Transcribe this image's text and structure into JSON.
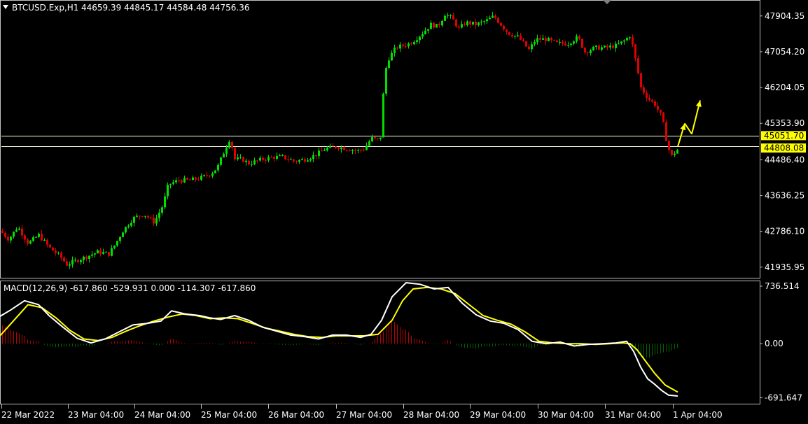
{
  "colors": {
    "background": "#000000",
    "border": "#c0c0c0",
    "text": "#ffffff",
    "bull": "#00e000",
    "bear": "#e00000",
    "level_line": "#ffffe0",
    "price_tag_bg": "#ffff00",
    "price_tag_text": "#000000",
    "arrow": "#ffff00",
    "macd_line": "#ffffff",
    "signal_line": "#ffff00",
    "hist_pos": "#c00000",
    "hist_neg": "#006400"
  },
  "price_panel": {
    "header": {
      "symbol": "BTCUSD.Exp,H1",
      "ohlc": "44659.39 44845.17 44584.48 44756.36",
      "dropdown_icon": "triangle-down-icon"
    }
  },
  "macd_panel": {
    "header": "MACD(12,26,9) -617.860 -529.931 0.000 -114.307 -617.860"
  },
  "chart_data": [
    {
      "type": "candlestick",
      "title": "BTCUSD.Exp,H1",
      "x_ticks": [
        "22 Mar 2022",
        "23 Mar 04:00",
        "24 Mar 04:00",
        "25 Mar 04:00",
        "26 Mar 04:00",
        "27 Mar 04:00",
        "28 Mar 04:00",
        "29 Mar 04:00",
        "30 Mar 04:00",
        "31 Mar 04:00",
        "1 Apr 04:00"
      ],
      "y_ticks": [
        "47904.35",
        "47054.20",
        "46204.05",
        "45353.90",
        "44486.40",
        "43636.25",
        "42786.10",
        "41935.95"
      ],
      "ylim": [
        41700,
        48250
      ],
      "price_levels": [
        45051.7,
        44808.08
      ],
      "price_level_labels": [
        "45051.70",
        "44808.08"
      ],
      "close_path": [
        [
          0,
          42800
        ],
        [
          12,
          42600
        ],
        [
          25,
          42900
        ],
        [
          40,
          42500
        ],
        [
          55,
          42700
        ],
        [
          70,
          42400
        ],
        [
          85,
          42200
        ],
        [
          95,
          42000
        ],
        [
          110,
          42100
        ],
        [
          125,
          42200
        ],
        [
          140,
          42300
        ],
        [
          155,
          42250
        ],
        [
          165,
          42500
        ],
        [
          175,
          42800
        ],
        [
          190,
          43100
        ],
        [
          205,
          43200
        ],
        [
          220,
          43000
        ],
        [
          232,
          43400
        ],
        [
          240,
          43900
        ],
        [
          255,
          44000
        ],
        [
          270,
          44000
        ],
        [
          285,
          44050
        ],
        [
          300,
          44150
        ],
        [
          310,
          44300
        ],
        [
          320,
          44700
        ],
        [
          328,
          45000
        ],
        [
          335,
          44500
        ],
        [
          345,
          44500
        ],
        [
          355,
          44400
        ],
        [
          365,
          44450
        ],
        [
          375,
          44500
        ],
        [
          390,
          44550
        ],
        [
          405,
          44550
        ],
        [
          420,
          44450
        ],
        [
          435,
          44500
        ],
        [
          450,
          44600
        ],
        [
          465,
          44750
        ],
        [
          480,
          44800
        ],
        [
          495,
          44750
        ],
        [
          510,
          44700
        ],
        [
          520,
          44750
        ],
        [
          530,
          45000
        ],
        [
          540,
          44950
        ],
        [
          545,
          45100
        ],
        [
          548,
          46500
        ],
        [
          555,
          46900
        ],
        [
          565,
          47150
        ],
        [
          575,
          47200
        ],
        [
          585,
          47250
        ],
        [
          600,
          47450
        ],
        [
          615,
          47700
        ],
        [
          625,
          47650
        ],
        [
          635,
          47950
        ],
        [
          645,
          47850
        ],
        [
          655,
          47600
        ],
        [
          665,
          47750
        ],
        [
          680,
          47700
        ],
        [
          695,
          47800
        ],
        [
          705,
          47900
        ],
        [
          715,
          47700
        ],
        [
          725,
          47500
        ],
        [
          740,
          47400
        ],
        [
          755,
          47100
        ],
        [
          765,
          47350
        ],
        [
          780,
          47350
        ],
        [
          795,
          47250
        ],
        [
          810,
          47250
        ],
        [
          825,
          47400
        ],
        [
          835,
          47050
        ],
        [
          850,
          47150
        ],
        [
          865,
          47150
        ],
        [
          880,
          47200
        ],
        [
          890,
          47300
        ],
        [
          900,
          47450
        ],
        [
          908,
          46800
        ],
        [
          915,
          46200
        ],
        [
          925,
          45950
        ],
        [
          935,
          45800
        ],
        [
          945,
          45500
        ],
        [
          952,
          44900
        ],
        [
          958,
          44550
        ],
        [
          965,
          44700
        ],
        [
          970,
          44750
        ]
      ],
      "annotations": [
        {
          "type": "arrow",
          "points": [
            [
              968,
              44800
            ],
            [
              978,
              45350
            ]
          ]
        },
        {
          "type": "arrow",
          "points": [
            [
              988,
              45100
            ],
            [
              1000,
              45900
            ]
          ]
        }
      ]
    },
    {
      "type": "line",
      "title": "MACD(12,26,9)",
      "y_ticks": [
        "736.514",
        "0.00",
        "-691.647"
      ],
      "ylim": [
        -760,
        790
      ],
      "series": [
        {
          "name": "MACD",
          "points": [
            [
              0,
              350
            ],
            [
              15,
              430
            ],
            [
              35,
              550
            ],
            [
              55,
              500
            ],
            [
              70,
              360
            ],
            [
              90,
              210
            ],
            [
              110,
              70
            ],
            [
              130,
              10
            ],
            [
              150,
              60
            ],
            [
              170,
              150
            ],
            [
              190,
              240
            ],
            [
              210,
              260
            ],
            [
              230,
              290
            ],
            [
              245,
              420
            ],
            [
              265,
              380
            ],
            [
              285,
              360
            ],
            [
              300,
              330
            ],
            [
              315,
              310
            ],
            [
              335,
              360
            ],
            [
              355,
              300
            ],
            [
              375,
              210
            ],
            [
              395,
              160
            ],
            [
              415,
              110
            ],
            [
              435,
              90
            ],
            [
              455,
              60
            ],
            [
              475,
              110
            ],
            [
              495,
              110
            ],
            [
              515,
              80
            ],
            [
              530,
              120
            ],
            [
              545,
              300
            ],
            [
              560,
              600
            ],
            [
              580,
              780
            ],
            [
              600,
              760
            ],
            [
              620,
              700
            ],
            [
              640,
              720
            ],
            [
              660,
              520
            ],
            [
              680,
              370
            ],
            [
              700,
              290
            ],
            [
              720,
              260
            ],
            [
              740,
              180
            ],
            [
              760,
              30
            ],
            [
              780,
              0
            ],
            [
              800,
              20
            ],
            [
              820,
              -30
            ],
            [
              840,
              -10
            ],
            [
              860,
              0
            ],
            [
              880,
              10
            ],
            [
              895,
              30
            ],
            [
              905,
              -100
            ],
            [
              915,
              -300
            ],
            [
              925,
              -450
            ],
            [
              935,
              -520
            ],
            [
              945,
              -600
            ],
            [
              955,
              -660
            ],
            [
              968,
              -670
            ]
          ]
        },
        {
          "name": "Signal",
          "points": [
            [
              0,
              100
            ],
            [
              20,
              300
            ],
            [
              40,
              500
            ],
            [
              60,
              460
            ],
            [
              80,
              330
            ],
            [
              100,
              170
            ],
            [
              120,
              60
            ],
            [
              140,
              40
            ],
            [
              160,
              80
            ],
            [
              180,
              160
            ],
            [
              200,
              230
            ],
            [
              220,
              290
            ],
            [
              240,
              340
            ],
            [
              260,
              380
            ],
            [
              280,
              360
            ],
            [
              300,
              320
            ],
            [
              320,
              330
            ],
            [
              340,
              320
            ],
            [
              360,
              260
            ],
            [
              380,
              200
            ],
            [
              400,
              160
            ],
            [
              420,
              120
            ],
            [
              440,
              90
            ],
            [
              460,
              80
            ],
            [
              480,
              100
            ],
            [
              500,
              100
            ],
            [
              520,
              100
            ],
            [
              540,
              120
            ],
            [
              560,
              300
            ],
            [
              575,
              550
            ],
            [
              590,
              700
            ],
            [
              610,
              720
            ],
            [
              630,
              700
            ],
            [
              650,
              640
            ],
            [
              670,
              500
            ],
            [
              690,
              360
            ],
            [
              710,
              300
            ],
            [
              730,
              250
            ],
            [
              750,
              150
            ],
            [
              770,
              30
            ],
            [
              790,
              10
            ],
            [
              810,
              0
            ],
            [
              830,
              0
            ],
            [
              850,
              -10
            ],
            [
              870,
              0
            ],
            [
              890,
              10
            ],
            [
              900,
              0
            ],
            [
              910,
              -80
            ],
            [
              920,
              -200
            ],
            [
              935,
              -380
            ],
            [
              950,
              -530
            ],
            [
              968,
              -620
            ]
          ]
        }
      ]
    }
  ]
}
